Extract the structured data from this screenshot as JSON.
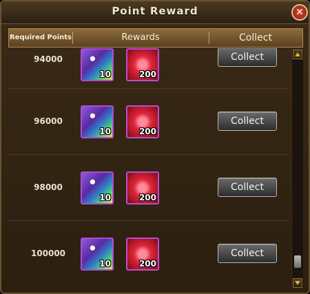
{
  "window": {
    "title": "Point Reward",
    "close_icon": "close-icon"
  },
  "header": {
    "required_points": "Required Points",
    "rewards": "Rewards",
    "collect": "Collect"
  },
  "rows": [
    {
      "points": "94000",
      "crystal_qty": "10",
      "star_qty": "200",
      "button": "Collect"
    },
    {
      "points": "96000",
      "crystal_qty": "10",
      "star_qty": "200",
      "button": "Collect"
    },
    {
      "points": "98000",
      "crystal_qty": "10",
      "star_qty": "200",
      "button": "Collect"
    },
    {
      "points": "100000",
      "crystal_qty": "10",
      "star_qty": "200",
      "button": "Collect"
    }
  ],
  "scrollbar": {
    "position_fraction": 0.95
  },
  "colors": {
    "frame": "#6b5333",
    "header": "#8c6a3b",
    "item_border": "#b14bd2",
    "arrow": "#e6b12a"
  }
}
